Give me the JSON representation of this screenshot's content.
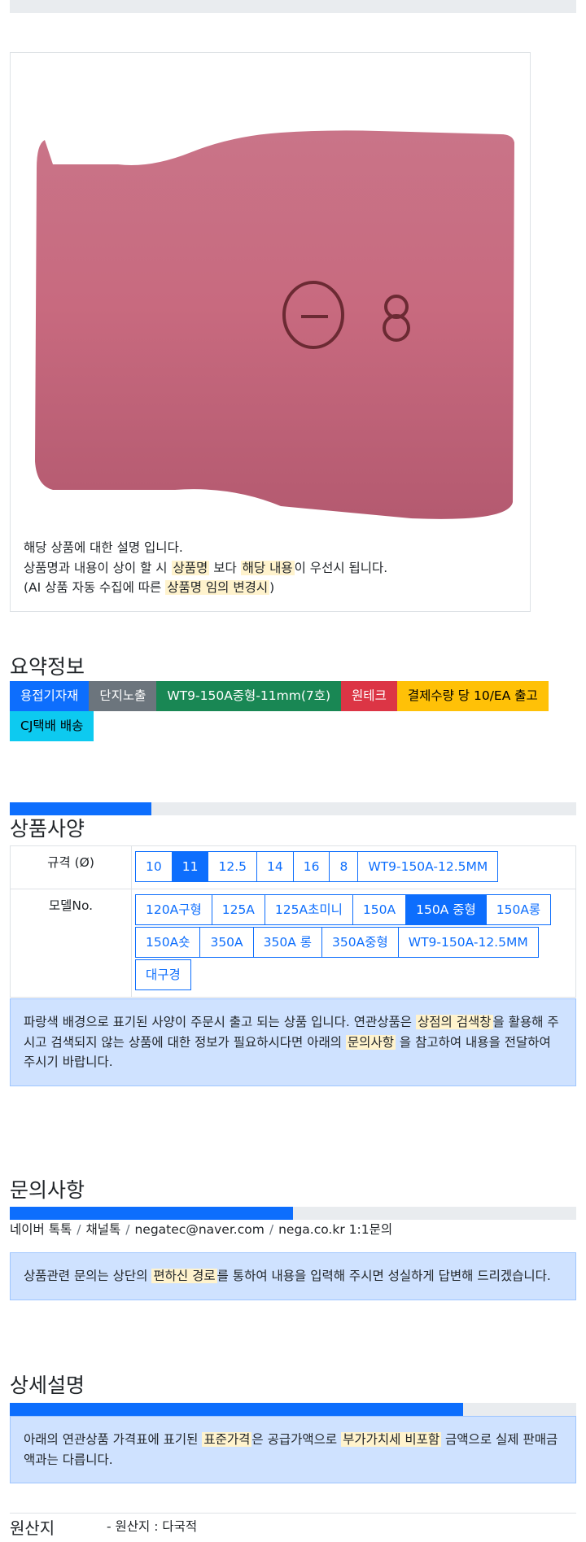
{
  "product": {
    "image_alt": "pink ceramic nozzle with number 8",
    "description": {
      "line1": "해당 상품에 대한 설명 입니다.",
      "line2_pre": "상품명과 내용이 상이 할 시 ",
      "line2_hl1": "상품명",
      "line2_mid": " 보다 ",
      "line2_hl2": "해당 내용",
      "line2_post": "이 우선시 됩니다.",
      "line3_pre": "(AI 상품 자동 수집에 따른 ",
      "line3_hl": "상품명 임의 변경시",
      "line3_post": ")"
    }
  },
  "summary": {
    "title": "요약정보",
    "badges": [
      {
        "label": "용접기자재",
        "color": "#0d6efd"
      },
      {
        "label": "단지노출",
        "color": "#6c757d"
      },
      {
        "label": "WT9-150A중형-11mm(7호)",
        "color": "#198754"
      },
      {
        "label": "원테크",
        "color": "#dc3545"
      },
      {
        "label": "결제수량 당 10/EA 출고",
        "color": "#ffc107"
      },
      {
        "label": "CJ택배 배송",
        "color": "#0dcaf0"
      }
    ]
  },
  "specs": {
    "title": "상품사양",
    "progress_fraction": 0.25,
    "size_label": "규격 (Ø)",
    "size_options": [
      "10",
      "11",
      "12.5",
      "14",
      "16",
      "8",
      "WT9-150A-12.5MM"
    ],
    "size_selected": "11",
    "model_label": "모델No.",
    "model_options": [
      "120A구형",
      "125A",
      "125A초미니",
      "150A",
      "150A 중형",
      "150A롱",
      "150A숏",
      "350A",
      "350A 롱",
      "350A중형",
      "WT9-150A-12.5MM",
      "대구경"
    ],
    "model_selected": "150A 중형",
    "notice": {
      "pre": "파랑색 배경으로 표기된 사양이 주문시 출고 되는 상품 입니다. 연관상품은 ",
      "hl1": "상점의 검색창",
      "mid": "을 활용해 주시고 검색되지 않는 상품에 대한 정보가 필요하시다면 아래의 ",
      "hl2": "문의사항",
      "post": " 을 참고하여 내용을 전달하여 주시기 바랍니다."
    }
  },
  "inquiry": {
    "title": "문의사항",
    "progress_fraction": 0.5,
    "links": [
      "네이버 톡톡",
      "채널톡",
      "negatec@naver.com",
      "nega.co.kr 1:1문의"
    ],
    "notice": {
      "pre": "상품관련 문의는 상단의 ",
      "hl": "편하신 경로",
      "post": "를 통하여 내용을 입력해 주시면 성실하게 답변해 드리겠습니다."
    }
  },
  "detail": {
    "title": "상세설명",
    "progress_fraction": 0.8,
    "notice": {
      "pre": "아래의 연관상품 가격표에 표기된 ",
      "hl1": "표준가격",
      "mid": "은 공급가액으로 ",
      "hl2": "부가가치세 비포함",
      "post": " 금액으로 실제 판매금액과는 다릅니다."
    }
  },
  "origin": {
    "label": "원산지",
    "value": "- 원산지 : 다국적"
  }
}
